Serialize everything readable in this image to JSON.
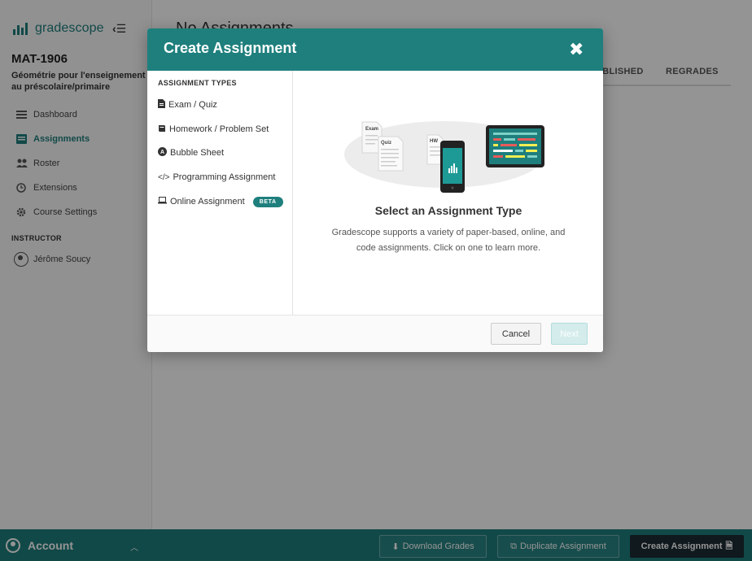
{
  "app": {
    "name": "gradescope"
  },
  "course": {
    "code": "MAT-1906",
    "name": "Géométrie pour l'enseignement au préscolaire/primaire"
  },
  "sidebar": {
    "items": [
      {
        "label": "Dashboard",
        "icon": "dashboard-icon"
      },
      {
        "label": "Assignments",
        "icon": "assignments-icon",
        "active": true
      },
      {
        "label": "Roster",
        "icon": "roster-icon"
      },
      {
        "label": "Extensions",
        "icon": "clock-icon"
      },
      {
        "label": "Course Settings",
        "icon": "gear-icon"
      }
    ],
    "section_header": "INSTRUCTOR",
    "instructor_name": "Jérôme Soucy"
  },
  "main": {
    "title": "No Assignments",
    "tabs": [
      "UBLISHED",
      "REGRADES"
    ]
  },
  "bottom_bar": {
    "account_label": "Account",
    "download_grades": "Download Grades",
    "duplicate_assignment": "Duplicate Assignment",
    "create_assignment": "Create Assignment"
  },
  "modal": {
    "title": "Create Assignment",
    "types_header": "ASSIGNMENT TYPES",
    "types": [
      {
        "label": "Exam / Quiz",
        "icon": "file-icon"
      },
      {
        "label": "Homework / Problem Set",
        "icon": "book-icon"
      },
      {
        "label": "Bubble Sheet",
        "icon": "bubble-icon"
      },
      {
        "label": "Programming Assignment",
        "icon": "code-icon"
      },
      {
        "label": "Online Assignment",
        "icon": "laptop-icon",
        "badge": "BETA"
      }
    ],
    "illustration_labels": {
      "exam": "Exam",
      "quiz": "Quiz",
      "hw": "HW"
    },
    "select_title": "Select an Assignment Type",
    "select_description": "Gradescope supports a variety of paper-based, online, and code assignments. Click on one to learn more.",
    "cancel_label": "Cancel",
    "next_label": "Next"
  },
  "colors": {
    "accent": "#1e7f7d",
    "dark": "#1c2b33"
  }
}
